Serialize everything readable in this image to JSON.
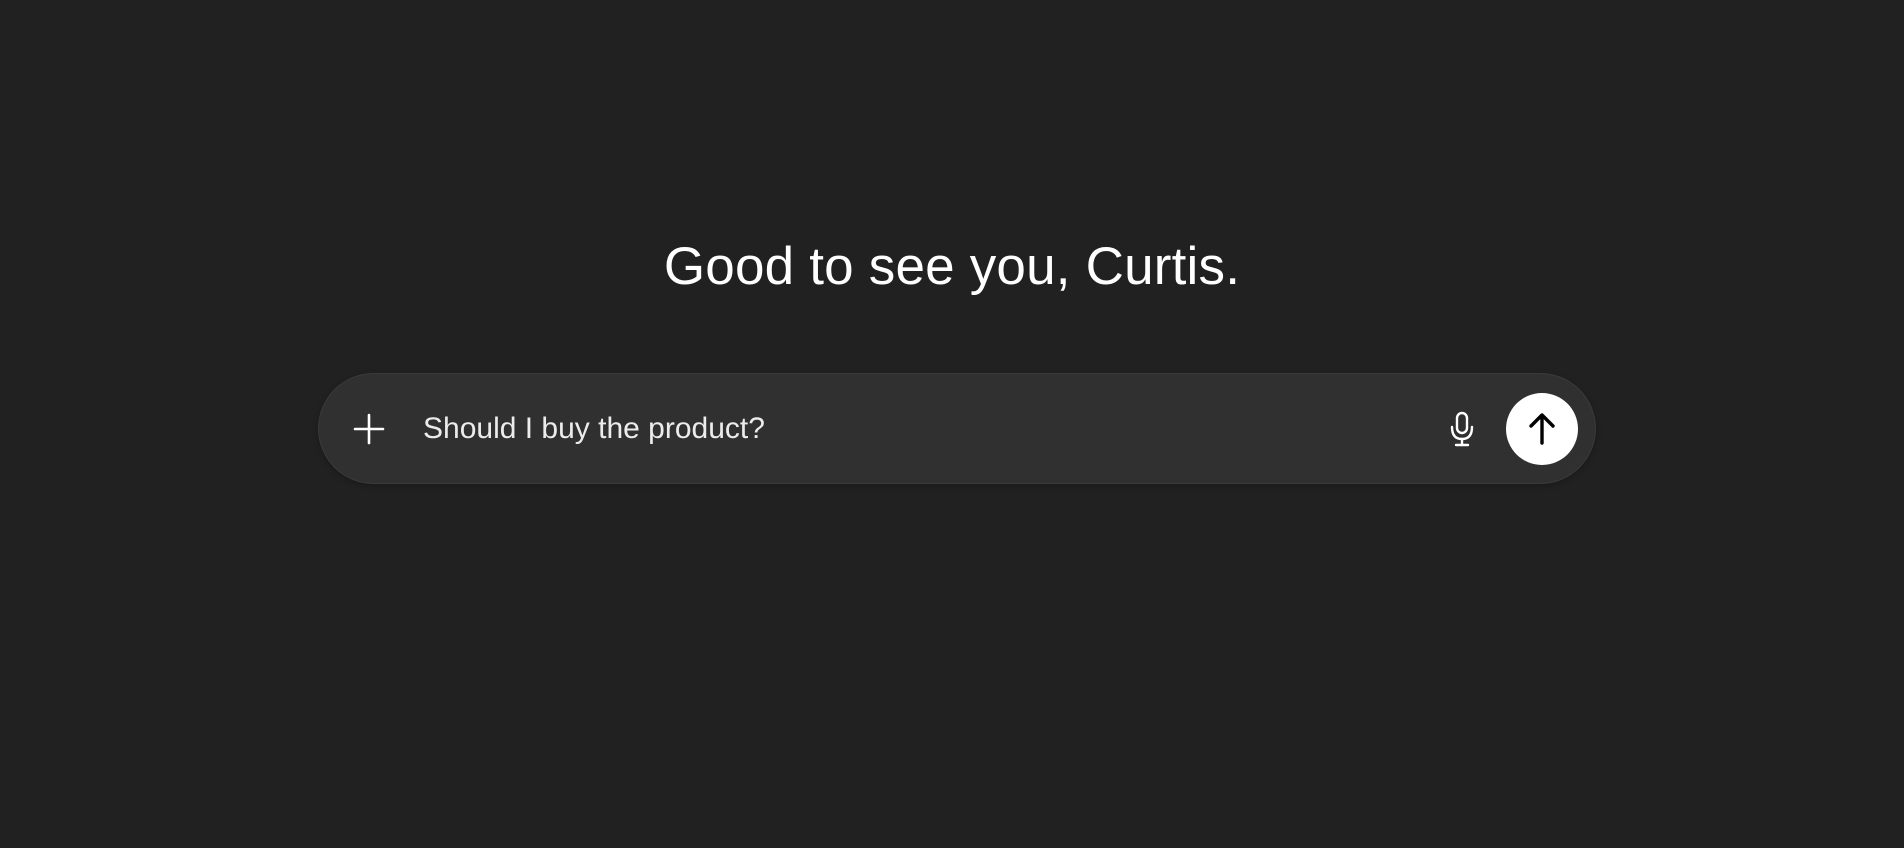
{
  "greeting": "Good to see you, Curtis.",
  "composer": {
    "input_value": "Should I buy the product?",
    "icons": {
      "attach": "plus-icon",
      "voice": "microphone-icon",
      "send": "arrow-up-icon"
    }
  },
  "colors": {
    "background": "#212121",
    "composer_background": "#303030",
    "text": "#ffffff",
    "send_button": "#ffffff",
    "send_icon": "#000000"
  }
}
